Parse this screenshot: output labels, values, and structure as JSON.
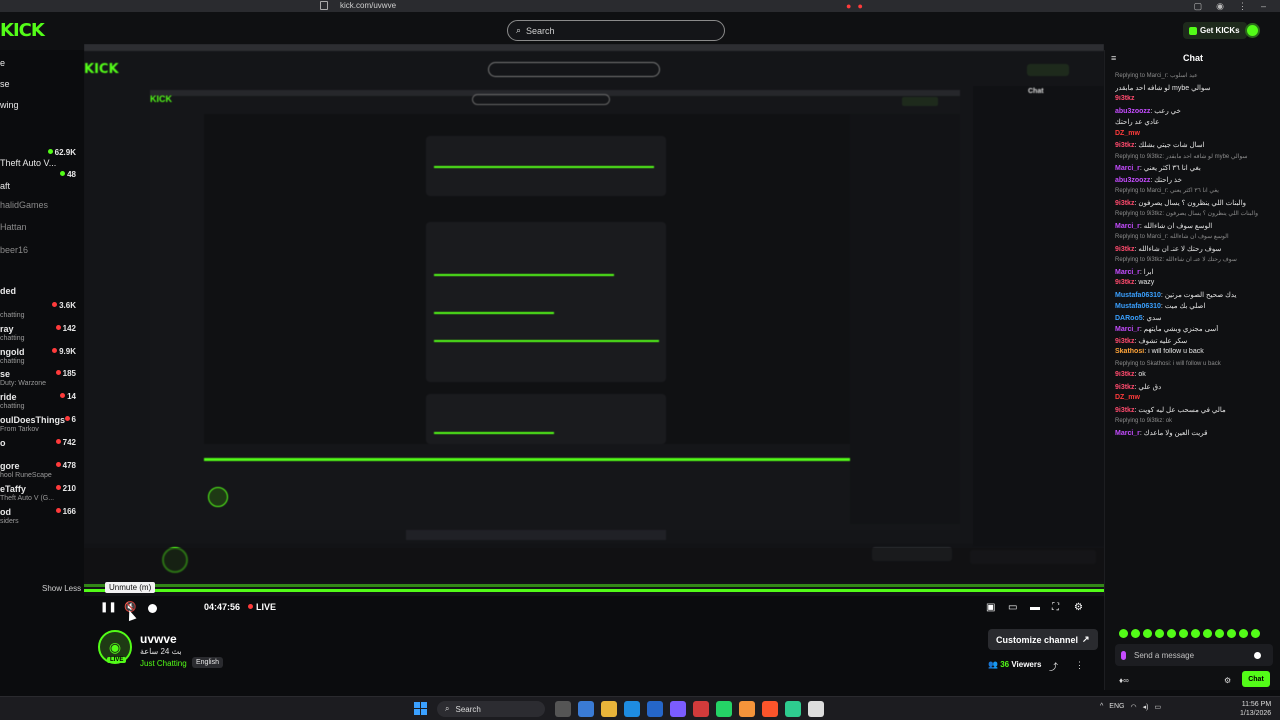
{
  "browser": {
    "url": "kick.com/uvwve"
  },
  "header": {
    "logo": "KICK",
    "search_placeholder": "Search",
    "get_kicks_label": "Get KICKs"
  },
  "sidebar": {
    "nav": [
      "e",
      "se",
      "wing"
    ],
    "items": [
      {
        "name": "Theft Auto V...",
        "sub": "",
        "count": "62.9K"
      },
      {
        "name": "aft",
        "sub": "",
        "count": "48"
      },
      {
        "name": "halidGames",
        "sub": "",
        "count": ""
      },
      {
        "name": "Hattan",
        "sub": "",
        "count": ""
      },
      {
        "name": "beer16",
        "sub": "",
        "count": ""
      }
    ],
    "section": "ded",
    "live": [
      {
        "name": "",
        "sub": "chatting",
        "count": "3.6K"
      },
      {
        "name": "ray",
        "sub": "chatting",
        "count": "142"
      },
      {
        "name": "ngold",
        "sub": "chatting",
        "count": "9.9K"
      },
      {
        "name": "se",
        "sub": "Duty: Warzone",
        "count": "185"
      },
      {
        "name": "ride",
        "sub": "chatting",
        "count": "14"
      },
      {
        "name": "oulDoesThings",
        "sub": "From Tarkov",
        "count": "6"
      },
      {
        "name": "o",
        "sub": "",
        "count": "742"
      },
      {
        "name": "gore",
        "sub": "hool RuneScape",
        "count": "478"
      },
      {
        "name": "eTaffy",
        "sub": "Theft Auto V (G...",
        "count": "210"
      },
      {
        "name": "od",
        "sub": "siders",
        "count": "166"
      }
    ],
    "show_less": "Show Less"
  },
  "player": {
    "unmute_tooltip": "Unmute (m)",
    "time": "04:47:56",
    "live": "LIVE"
  },
  "channel": {
    "name": "uvwve",
    "title": "بث 24 ساعة",
    "category": "Just Chatting",
    "language": "English",
    "live_badge": "LIVE",
    "customize_label": "Customize channel",
    "viewers_count": "36",
    "viewers_label": "Viewers"
  },
  "chat": {
    "title": "Chat",
    "messages": [
      {
        "reply": "Replying to Marci_r: عيد اسلوب",
        "user": "",
        "text": ""
      },
      {
        "reply": "",
        "user": "",
        "text": "لو شافه احد مابقدر mybe سوالي",
        "color": "#e6e6e6"
      },
      {
        "reply": "",
        "user": "9i3tkz",
        "text": "",
        "color": "#ff4a6d"
      },
      {
        "reply": "",
        "user": "abu3zoozz",
        "text": ": خي رعب",
        "color": "#c54cff"
      },
      {
        "reply": "",
        "user": "",
        "text": "عادي عد راحتك",
        "color": "#e6e6e6"
      },
      {
        "reply": "",
        "user": "DZ_mw",
        "text": "",
        "color": "#ff3b3b"
      },
      {
        "reply": "",
        "user": "9i3tkz",
        "text": ": اسال شات جيتي بشلك",
        "color": "#ff4a6d"
      },
      {
        "reply": "Replying to 9i3tkz: لو شافه احد مابقدر mybe سوالي",
        "user": "",
        "text": ""
      },
      {
        "reply": "",
        "user": "Marci_r",
        "text": ": بغي انا ٣٦ اكثر يعني",
        "color": "#c54cff"
      },
      {
        "reply": "",
        "user": "abu3zoozz",
        "text": ": خذ راحتك",
        "color": "#c54cff"
      },
      {
        "reply": "Replying to Marci_r: يغي انا ٣٦ اكثر يعني",
        "user": "",
        "text": ""
      },
      {
        "reply": "",
        "user": "9i3tkz",
        "text": ": والبنات اللي ينظرون ؟ يسال يصرفون",
        "color": "#ff4a6d"
      },
      {
        "reply": "Replying to 9i3tkz: والبنات اللي ينظرون ؟ يسال يصرفون",
        "user": "",
        "text": ""
      },
      {
        "reply": "",
        "user": "Marci_r",
        "text": ": الوسع سوف ان شاءالله",
        "color": "#c54cff"
      },
      {
        "reply": "Replying to Marci_r: الوسع سوف ان شاءالله",
        "user": "",
        "text": ""
      },
      {
        "reply": "",
        "user": "9i3tkz",
        "text": ": سوف رحتك لا عنـ ان شاءالله",
        "color": "#ff4a6d"
      },
      {
        "reply": "Replying to 9i3tkz: سوف رحتك لا عنـ ان شاءالله",
        "user": "",
        "text": ""
      },
      {
        "reply": "",
        "user": "Marci_r",
        "text": ": ابرا",
        "color": "#c54cff"
      },
      {
        "reply": "",
        "user": "9i3tkz",
        "text": ": wazy",
        "color": "#ff4a6d"
      },
      {
        "reply": "",
        "user": "Mustafa06310",
        "text": ": يدك صحيح الصوت مرتين",
        "color": "#3aa0ff"
      },
      {
        "reply": "",
        "user": "Mustafa06310",
        "text": ": اصلي بك ميت",
        "color": "#3aa0ff"
      },
      {
        "reply": "",
        "user": "DARoo5",
        "text": ": سدي",
        "color": "#3aa0ff"
      },
      {
        "reply": "",
        "user": "Marci_r",
        "text": ": أسى مجنزي وبشي مايتهم",
        "color": "#c54cff"
      },
      {
        "reply": "",
        "user": "9i3tkz",
        "text": ": سكر عليه تشوف",
        "color": "#ff4a6d"
      },
      {
        "reply": "",
        "user": "Skathosi",
        "text": ": i will follow u back",
        "color": "#ffa43a"
      },
      {
        "reply": "Replying to Skathosi: i will follow u back",
        "user": "",
        "text": ""
      },
      {
        "reply": "",
        "user": "9i3tkz",
        "text": ": ok",
        "color": "#ff4a6d"
      },
      {
        "reply": "",
        "user": "9i3tkz",
        "text": ": دق علي",
        "color": "#ff4a6d"
      },
      {
        "reply": "",
        "user": "DZ_mw",
        "text": "",
        "color": "#ff3b3b"
      },
      {
        "reply": "",
        "user": "9i3tkz",
        "text": ": مالي في مسحب عل ليه كويت",
        "color": "#ff4a6d"
      },
      {
        "reply": "Replying to 9i3tkz: ok",
        "user": "",
        "text": ""
      },
      {
        "reply": "",
        "user": "Marci_r",
        "text": ": قريت العين ولا ماعدك",
        "color": "#c54cff"
      }
    ],
    "input_placeholder": "Send a message",
    "send_label": "Chat"
  },
  "taskbar": {
    "search_label": "Search",
    "lang": "ENG",
    "time": "11:56 PM",
    "date": "1/13/2026"
  },
  "colors": {
    "accent": "#53fc18",
    "background": "#0b0c0e",
    "live": "#ff3b3b"
  }
}
